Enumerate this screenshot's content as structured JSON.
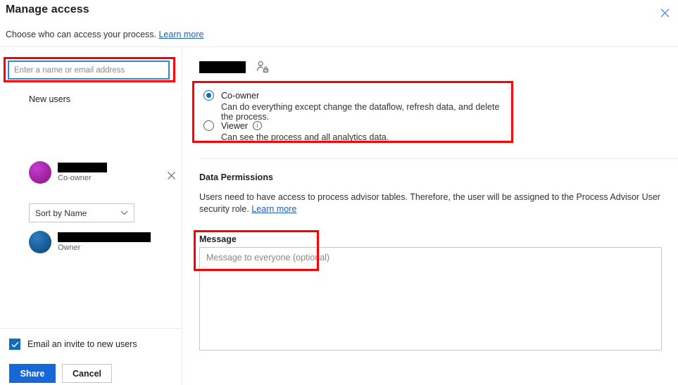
{
  "dialog": {
    "title": "Manage access",
    "subtitle": "Choose who can access your process.",
    "subtitle_link": "Learn more",
    "close_icon": "close-icon"
  },
  "left": {
    "search": {
      "placeholder": "Enter a name or email address",
      "value": ""
    },
    "new_users_label": "New users",
    "users": [
      {
        "name": "",
        "role": "Co-owner",
        "avatar_color": "#a1219f",
        "avatar_initials": "",
        "redacted": true,
        "removable": true
      },
      {
        "name": "",
        "role": "Owner",
        "avatar_color": "#14588f",
        "avatar_initials": "",
        "redacted": true,
        "removable": false
      }
    ],
    "remove_icon": "close-icon",
    "sort": {
      "selected": "Sort by Name",
      "chevron_icon": "chevron-down-icon",
      "options": [
        "Sort by Name"
      ]
    },
    "email_invite": {
      "label": "Email an invite to new users",
      "checked": true,
      "check_icon": "checkmark-icon"
    },
    "buttons": {
      "primary": "Share",
      "secondary": "Cancel"
    }
  },
  "right": {
    "selected_user": {
      "name": "",
      "redacted": true,
      "icon": "person-lock-icon"
    },
    "permissions": [
      {
        "label": "Co-owner",
        "description": "Can do everything except change the dataflow, refresh data, and delete the process.",
        "selected": true,
        "has_info": false
      },
      {
        "label": "Viewer",
        "description": "Can see the process and all analytics data.",
        "selected": false,
        "has_info": true,
        "info_icon": "info-icon"
      }
    ],
    "data_permissions": {
      "title": "Data Permissions",
      "body": "Users need to have access to process advisor tables. Therefore, the user will be assigned to the Process Advisor User security role. ",
      "link": "Learn more"
    },
    "message": {
      "label": "Message",
      "placeholder": "Message to everyone (optional)",
      "value": ""
    }
  },
  "colors": {
    "accent": "#0f6cbd",
    "primary_button": "#1668d9",
    "link": "#1b5ebe",
    "highlight": "#ff0000",
    "focus_border": "#2b88d8"
  }
}
